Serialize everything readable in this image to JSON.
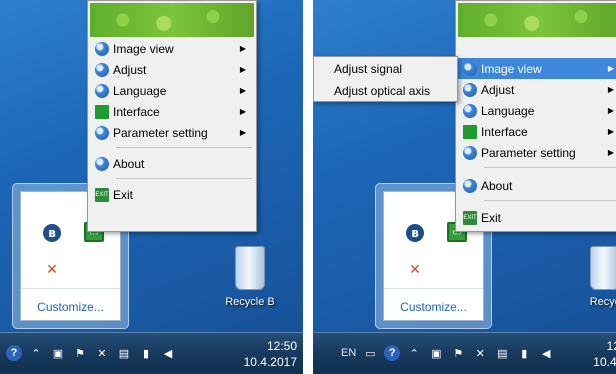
{
  "left": {
    "menu": {
      "items": [
        {
          "label": "Image view"
        },
        {
          "label": "Adjust"
        },
        {
          "label": "Language"
        },
        {
          "label": "Interface"
        },
        {
          "label": "Parameter setting"
        },
        {
          "label": "About"
        },
        {
          "label": "Exit"
        }
      ]
    },
    "tray": {
      "customize": "Customize..."
    },
    "recycle_bin": {
      "label": "Recycle B"
    },
    "clock": {
      "time": "12:50",
      "date": "10.4.2017"
    }
  },
  "right": {
    "menu": {
      "items": [
        {
          "label": "Image view"
        },
        {
          "label": "Adjust"
        },
        {
          "label": "Language"
        },
        {
          "label": "Interface"
        },
        {
          "label": "Parameter setting"
        },
        {
          "label": "About"
        },
        {
          "label": "Exit"
        }
      ],
      "highlighted": "Image view"
    },
    "submenu": {
      "items": [
        "Adjust signal",
        "Adjust optical axis"
      ]
    },
    "tray": {
      "customize": "Customize..."
    },
    "recycle_bin": {
      "label": "Recyc"
    },
    "taskbar": {
      "language": "EN"
    },
    "clock": {
      "time": "12",
      "date": "10.4."
    }
  },
  "colors": {
    "highlight": "#3c87dc",
    "desktop": "#1d67b8",
    "menu_bg": "#f0f0f0",
    "banner": "#7cc43a"
  },
  "icons": [
    "bluetooth-icon",
    "monitor-icon",
    "network-plug-icon",
    "help-icon",
    "flag-icon",
    "volume-icon",
    "signal-icon"
  ]
}
